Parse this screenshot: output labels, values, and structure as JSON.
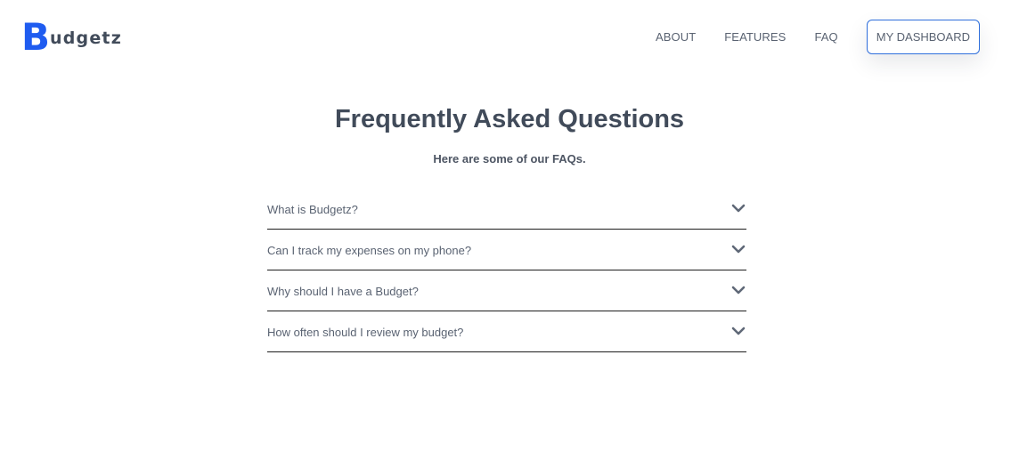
{
  "brand": {
    "logo_initial": "B",
    "logo_rest": "udgetz"
  },
  "nav": {
    "items": [
      "ABOUT",
      "FEATURES",
      "FAQ"
    ],
    "dashboard_button": "MY DASHBOARD"
  },
  "faq": {
    "title": "Frequently Asked Questions",
    "subtitle": "Here are some of our FAQs.",
    "questions": [
      "What is Budgetz?",
      "Can I track my expenses on my phone?",
      "Why should I have a Budget?",
      "How often should I review my budget?"
    ]
  },
  "icons": {
    "expand": "chevron-down-icon"
  },
  "colors": {
    "brand_blue": "#1f5cf0",
    "text_dark": "#414b5a",
    "button_border": "#2f6fdc"
  }
}
